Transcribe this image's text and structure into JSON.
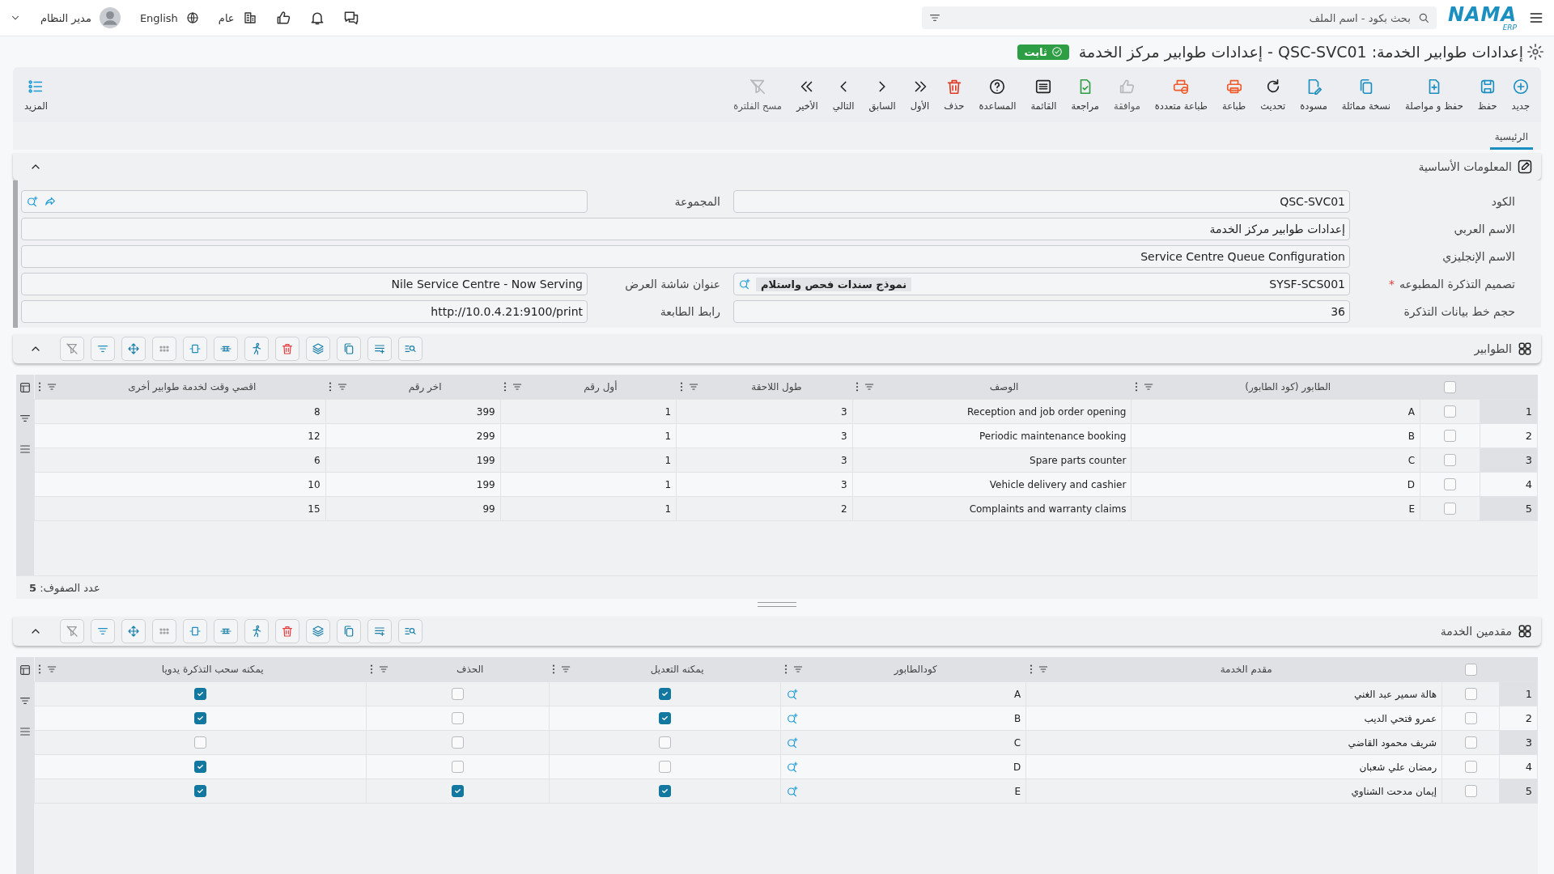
{
  "topbar": {
    "logo": "NAMA",
    "logo_sub": "ERP",
    "search": {
      "placeholder": "بحث بكود - اسم الملف"
    },
    "company": "عام",
    "language": "English",
    "user": "مدير النظام"
  },
  "page": {
    "title": "إعدادات طوابير الخدمة: QSC-SVC01 - إعدادات طوابير مركز الخدمة",
    "status": "ثابت"
  },
  "toolbar": {
    "actions": [
      {
        "label": "جديد",
        "kind": "new",
        "disabled": false
      },
      {
        "label": "حفظ",
        "kind": "save",
        "disabled": false
      },
      {
        "label": "حفظ و مواصلة",
        "kind": "save_continue",
        "disabled": false
      },
      {
        "label": "نسخة مماثلة",
        "kind": "duplicate",
        "disabled": false
      },
      {
        "label": "مسودة",
        "kind": "draft",
        "disabled": false
      },
      {
        "label": "تحديث",
        "kind": "refresh",
        "disabled": false
      },
      {
        "label": "طباعة",
        "kind": "print",
        "disabled": false
      },
      {
        "label": "طباعة متعددة",
        "kind": "multi_print",
        "disabled": false
      },
      {
        "label": "موافقة",
        "kind": "approve",
        "disabled": true
      },
      {
        "label": "مراجعة",
        "kind": "review",
        "disabled": false
      },
      {
        "label": "القائمة",
        "kind": "list",
        "disabled": false
      },
      {
        "label": "المساعدة",
        "kind": "help",
        "disabled": false
      },
      {
        "label": "حذف",
        "kind": "delete",
        "disabled": false
      },
      {
        "label": "الأول",
        "kind": "first",
        "disabled": false
      },
      {
        "label": "السابق",
        "kind": "previous",
        "disabled": false
      },
      {
        "label": "التالي",
        "kind": "next",
        "disabled": false
      },
      {
        "label": "الأخير",
        "kind": "last",
        "disabled": false
      },
      {
        "label": "مسح الفلترة",
        "kind": "clear_filter",
        "disabled": true
      }
    ],
    "more": "المزيد"
  },
  "tabs": [
    {
      "label": "الرئيسية",
      "selected": true
    }
  ],
  "basic_info": {
    "title": "المعلومات الأساسية",
    "expanded": true,
    "required_mark": "*",
    "fields": [
      {
        "label": "الكود",
        "kind": "text",
        "value": "QSC-SVC01",
        "required": false
      },
      {
        "label": "المجموعة",
        "kind": "lookup",
        "required": false
      },
      {
        "label": "الاسم العربي",
        "kind": "wide",
        "value": "إعدادات طوابير مركز الخدمة",
        "required": false
      },
      {
        "label": "الاسم الإنجليزي",
        "kind": "wide",
        "value": "Service Centre Queue Configuration",
        "required": false
      },
      {
        "label": "تصميم التذكرة المطبوعه",
        "kind": "design",
        "value": "SYSF-SCS001",
        "tag": "نموذج سندات فحص واستلام",
        "required": true
      },
      {
        "label": "عنوان شاشة العرض",
        "kind": "text",
        "value": "Nile Service Centre - Now Serving",
        "required": false
      },
      {
        "label": "حجم خط بيانات التذكرة",
        "kind": "text",
        "value": "36",
        "required": false
      },
      {
        "label": "رابط الطابعة",
        "kind": "text",
        "value": "http://10.0.4.21:9100/print",
        "required": false
      }
    ]
  },
  "queues": {
    "title": "الطوابير",
    "expanded": true,
    "all_selected": false,
    "columns": [
      "الطابور (كود الطابور)",
      "الوصف",
      "طول اللاحقة",
      "أول رقم",
      "اخر رقم",
      "اقصي وقت لخدمة طوابير أخرى"
    ],
    "rows": [
      {
        "no": "1",
        "selected": false,
        "cells": [
          "A",
          "Reception and job order opening",
          "3",
          "1",
          "399",
          "8"
        ]
      },
      {
        "no": "2",
        "selected": false,
        "cells": [
          "B",
          "Periodic maintenance booking",
          "3",
          "1",
          "299",
          "12"
        ]
      },
      {
        "no": "3",
        "selected": false,
        "cells": [
          "C",
          "Spare parts counter",
          "3",
          "1",
          "199",
          "6"
        ]
      },
      {
        "no": "4",
        "selected": false,
        "cells": [
          "D",
          "Vehicle delivery and cashier",
          "3",
          "1",
          "199",
          "10"
        ]
      },
      {
        "no": "5",
        "selected": false,
        "cells": [
          "E",
          "Complaints and warranty claims",
          "2",
          "1",
          "99",
          "15"
        ]
      }
    ],
    "row_count": "عدد الصفوف: **5**"
  },
  "providers": {
    "title": "مقدمين الخدمة",
    "expanded": true,
    "all_selected": false,
    "columns": [
      "مقدم الخدمة",
      "كودالطابور",
      "يمكنه التعديل",
      "الحذف",
      "يمكنه سحب التذكرة يدويا"
    ],
    "rows": [
      {
        "no": "1",
        "selected": false,
        "name": "هالة سمير عبد الغني",
        "queue_code": "A",
        "can_edit": true,
        "can_delete": false,
        "can_pull": true
      },
      {
        "no": "2",
        "selected": false,
        "name": "عمرو فتحي الديب",
        "queue_code": "B",
        "can_edit": true,
        "can_delete": false,
        "can_pull": true
      },
      {
        "no": "3",
        "selected": false,
        "name": "شريف محمود القاضي",
        "queue_code": "C",
        "can_edit": false,
        "can_delete": false,
        "can_pull": false
      },
      {
        "no": "4",
        "selected": false,
        "name": "رمضان علي شعبان",
        "queue_code": "D",
        "can_edit": false,
        "can_delete": false,
        "can_pull": true
      },
      {
        "no": "5",
        "selected": false,
        "name": "إيمان مدحت الشناوي",
        "queue_code": "E",
        "can_edit": true,
        "can_delete": true,
        "can_pull": true
      }
    ]
  }
}
